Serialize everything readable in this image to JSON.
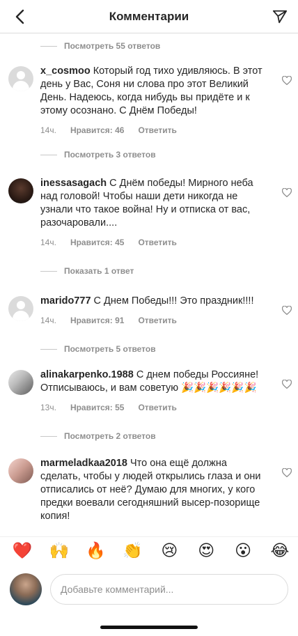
{
  "header": {
    "title": "Комментарии",
    "back_icon": "chevron-left-icon",
    "send_icon": "paper-plane-icon"
  },
  "threads": [
    {
      "type": "replies",
      "label": "Посмотреть 55 ответов"
    },
    {
      "type": "comment",
      "username": "x_cosmoo",
      "text": "Который год тихо удивляюсь. В этот день у Вас, Соня ни слова про этот Великий День. Надеюсь, когда нибудь вы придёте и к этому осознано. С Днём Победы!",
      "time": "14ч.",
      "likes": "Нравится: 46",
      "reply": "Ответить",
      "avatar": "default"
    },
    {
      "type": "replies",
      "label": "Посмотреть 3 ответов"
    },
    {
      "type": "comment",
      "username": "inessasagach",
      "text": "С Днём победы! Мирного неба над головой! Чтобы наши дети никогда не узнали что такое война! Ну и отписка от вас, разочаровали....",
      "time": "14ч.",
      "likes": "Нравится: 45",
      "reply": "Ответить",
      "avatar": "dark"
    },
    {
      "type": "replies",
      "label": "Показать 1 ответ"
    },
    {
      "type": "comment",
      "username": "marido777",
      "text": "С Днем Победы!!! Это праздник!!!!",
      "time": "14ч.",
      "likes": "Нравится: 91",
      "reply": "Ответить",
      "avatar": "default"
    },
    {
      "type": "replies",
      "label": "Посмотреть 5 ответов"
    },
    {
      "type": "comment",
      "username": "alinakarpenko.1988",
      "text": "С днем победы Россияне! Отписываюсь, и вам советую 🎉🎉🎉🎉🎉🎉",
      "time": "13ч.",
      "likes": "Нравится: 55",
      "reply": "Ответить",
      "avatar": "girl"
    },
    {
      "type": "replies",
      "label": "Посмотреть 2 ответов"
    },
    {
      "type": "comment",
      "username": "marmeladkaa2018",
      "text": "Что она ещё должна сделать, чтобы у людей открылись глаза и они отписались от неё? Думаю для многих, у кого предки воевали сегодняшний высер-позорище копия!",
      "time": "",
      "likes": "",
      "reply": "",
      "avatar": "pink"
    }
  ],
  "emoji_bar": [
    "❤️",
    "🙌",
    "🔥",
    "👏",
    "😢",
    "😍",
    "😮",
    "😂"
  ],
  "compose": {
    "placeholder": "Добавьте комментарий..."
  },
  "colors": {
    "text": "#262626",
    "secondary": "#8e8e8e",
    "border": "#dbdbdb",
    "heart": "#ed4956"
  }
}
